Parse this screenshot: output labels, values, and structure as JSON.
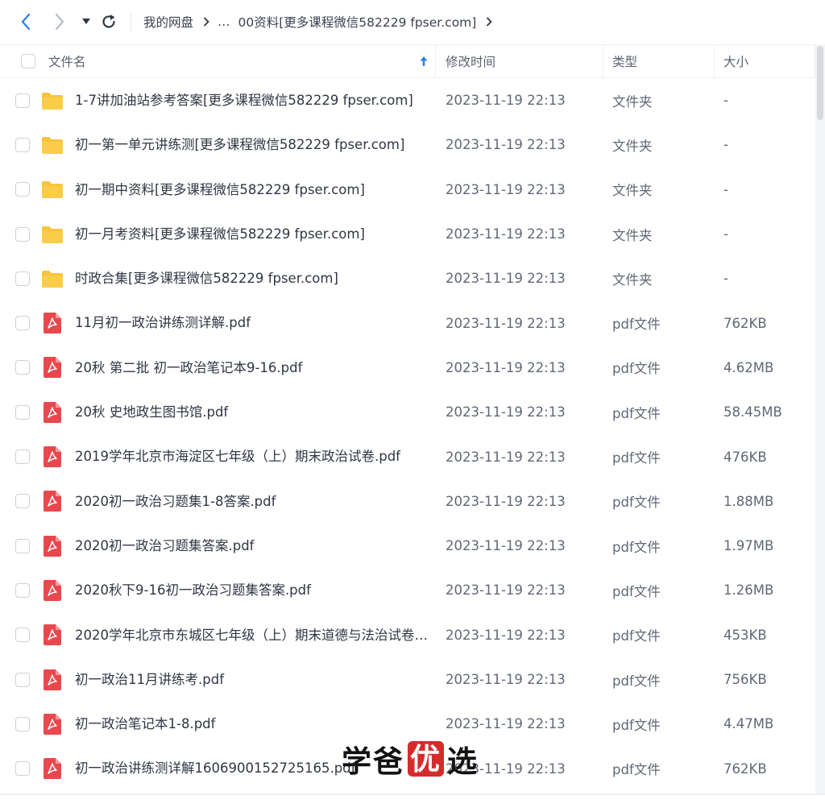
{
  "nav": {
    "breadcrumb": [
      "我的网盘",
      "…",
      "00资料[更多课程微信582229 fpser.com]"
    ]
  },
  "header": {
    "name": "文件名",
    "time": "修改时间",
    "type": "类型",
    "size": "大小"
  },
  "rows": [
    {
      "kind": "folder",
      "name": "1-7讲加油站参考答案[更多课程微信582229 fpser.com]",
      "time": "2023-11-19 22:13",
      "type": "文件夹",
      "size": "-"
    },
    {
      "kind": "folder",
      "name": "初一第一单元讲练测[更多课程微信582229 fpser.com]",
      "time": "2023-11-19 22:13",
      "type": "文件夹",
      "size": "-"
    },
    {
      "kind": "folder",
      "name": "初一期中资料[更多课程微信582229 fpser.com]",
      "time": "2023-11-19 22:13",
      "type": "文件夹",
      "size": "-"
    },
    {
      "kind": "folder",
      "name": "初一月考资料[更多课程微信582229 fpser.com]",
      "time": "2023-11-19 22:13",
      "type": "文件夹",
      "size": "-"
    },
    {
      "kind": "folder",
      "name": "时政合集[更多课程微信582229 fpser.com]",
      "time": "2023-11-19 22:13",
      "type": "文件夹",
      "size": "-"
    },
    {
      "kind": "pdf",
      "name": "11月初一政治讲练测详解.pdf",
      "time": "2023-11-19 22:13",
      "type": "pdf文件",
      "size": "762KB"
    },
    {
      "kind": "pdf",
      "name": "20秋 第二批  初一政治笔记本9-16.pdf",
      "time": "2023-11-19 22:13",
      "type": "pdf文件",
      "size": "4.62MB"
    },
    {
      "kind": "pdf",
      "name": "20秋 史地政生图书馆.pdf",
      "time": "2023-11-19 22:13",
      "type": "pdf文件",
      "size": "58.45MB"
    },
    {
      "kind": "pdf",
      "name": "2019学年北京市海淀区七年级（上）期末政治试卷.pdf",
      "time": "2023-11-19 22:13",
      "type": "pdf文件",
      "size": "476KB"
    },
    {
      "kind": "pdf",
      "name": "2020初一政治习题集1-8答案.pdf",
      "time": "2023-11-19 22:13",
      "type": "pdf文件",
      "size": "1.88MB"
    },
    {
      "kind": "pdf",
      "name": "2020初一政治习题集答案.pdf",
      "time": "2023-11-19 22:13",
      "type": "pdf文件",
      "size": "1.97MB"
    },
    {
      "kind": "pdf",
      "name": "2020秋下9-16初一政治习题集答案.pdf",
      "time": "2023-11-19 22:13",
      "type": "pdf文件",
      "size": "1.26MB"
    },
    {
      "kind": "pdf",
      "name": "2020学年北京市东城区七年级（上）期末道德与法治试卷…",
      "time": "2023-11-19 22:13",
      "type": "pdf文件",
      "size": "453KB"
    },
    {
      "kind": "pdf",
      "name": "初一政治11月讲练考.pdf",
      "time": "2023-11-19 22:13",
      "type": "pdf文件",
      "size": "756KB"
    },
    {
      "kind": "pdf",
      "name": "初一政治笔记本1-8.pdf",
      "time": "2023-11-19 22:13",
      "type": "pdf文件",
      "size": "4.47MB"
    },
    {
      "kind": "pdf",
      "name": "初一政治讲练测详解1606900152725165.pdf",
      "time": "2023-11-19 22:13",
      "type": "pdf文件",
      "size": "762KB"
    }
  ],
  "watermark": [
    "学爸",
    "优",
    "选"
  ],
  "icons": {
    "back": "chevron-left-icon",
    "forward": "chevron-right-icon",
    "dropdown": "caret-down-icon",
    "refresh": "refresh-icon",
    "sort": "arrow-up-icon",
    "folder": "folder-icon",
    "pdf": "pdf-icon"
  },
  "colors": {
    "accent": "#2b7de9",
    "folder": "#f8c43a",
    "pdf": "#e8484d",
    "text": "#2f3643",
    "muted": "#606876"
  }
}
